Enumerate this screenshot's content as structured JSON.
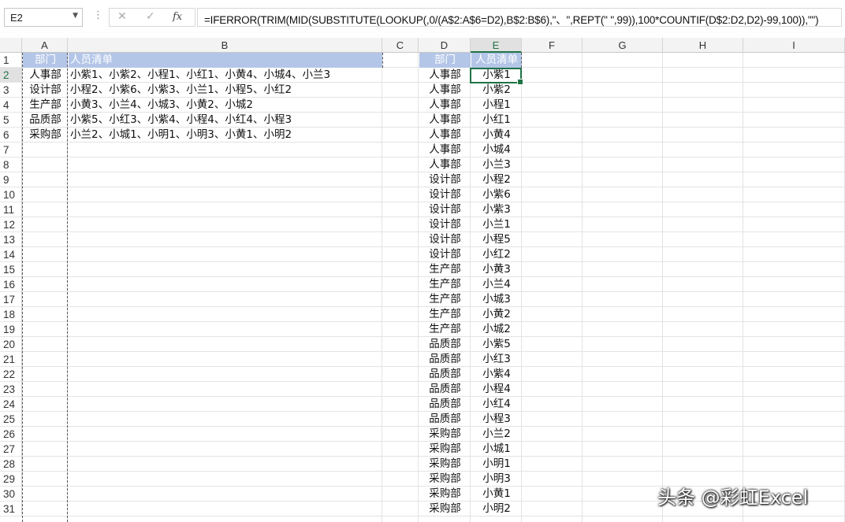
{
  "formula_bar": {
    "name_box": "E2",
    "more_icon": "⋮",
    "cancel_icon": "✕",
    "enter_icon": "✓",
    "fx_icon": "fx",
    "formula": "=IFERROR(TRIM(MID(SUBSTITUTE(LOOKUP(,0/(A$2:A$6=D2),B$2:B$6),\"、\",REPT(\" \",99)),100*COUNTIF(D$2:D2,D2)-99,100)),\"\")"
  },
  "columns": [
    {
      "label": "A"
    },
    {
      "label": "B"
    },
    {
      "label": "C"
    },
    {
      "label": "D"
    },
    {
      "label": "E"
    },
    {
      "label": "F"
    },
    {
      "label": "G"
    },
    {
      "label": "H"
    },
    {
      "label": "I"
    }
  ],
  "rows": [
    "1",
    "2",
    "3",
    "4",
    "5",
    "6",
    "7",
    "8",
    "9",
    "10",
    "11",
    "12",
    "13",
    "14",
    "15",
    "16",
    "17",
    "18",
    "19",
    "20",
    "21",
    "22",
    "23",
    "24",
    "25",
    "26",
    "27",
    "28",
    "29",
    "30",
    "31"
  ],
  "source_table": {
    "header": {
      "dept": "部门",
      "list": "人员清单"
    },
    "rows": [
      {
        "dept": "人事部",
        "list": "小紫1、小紫2、小程1、小红1、小黄4、小城4、小兰3"
      },
      {
        "dept": "设计部",
        "list": "小程2、小紫6、小紫3、小兰1、小程5、小红2"
      },
      {
        "dept": "生产部",
        "list": "小黄3、小兰4、小城3、小黄2、小城2"
      },
      {
        "dept": "品质部",
        "list": "小紫5、小红3、小紫4、小程4、小红4、小程3"
      },
      {
        "dept": "采购部",
        "list": "小兰2、小城1、小明1、小明3、小黄1、小明2"
      }
    ]
  },
  "result_table": {
    "header": {
      "dept": "部门",
      "name": "人员清单"
    },
    "rows": [
      {
        "dept": "人事部",
        "name": "小紫1"
      },
      {
        "dept": "人事部",
        "name": "小紫2"
      },
      {
        "dept": "人事部",
        "name": "小程1"
      },
      {
        "dept": "人事部",
        "name": "小红1"
      },
      {
        "dept": "人事部",
        "name": "小黄4"
      },
      {
        "dept": "人事部",
        "name": "小城4"
      },
      {
        "dept": "人事部",
        "name": "小兰3"
      },
      {
        "dept": "设计部",
        "name": "小程2"
      },
      {
        "dept": "设计部",
        "name": "小紫6"
      },
      {
        "dept": "设计部",
        "name": "小紫3"
      },
      {
        "dept": "设计部",
        "name": "小兰1"
      },
      {
        "dept": "设计部",
        "name": "小程5"
      },
      {
        "dept": "设计部",
        "name": "小红2"
      },
      {
        "dept": "生产部",
        "name": "小黄3"
      },
      {
        "dept": "生产部",
        "name": "小兰4"
      },
      {
        "dept": "生产部",
        "name": "小城3"
      },
      {
        "dept": "生产部",
        "name": "小黄2"
      },
      {
        "dept": "生产部",
        "name": "小城2"
      },
      {
        "dept": "品质部",
        "name": "小紫5"
      },
      {
        "dept": "品质部",
        "name": "小红3"
      },
      {
        "dept": "品质部",
        "name": "小紫4"
      },
      {
        "dept": "品质部",
        "name": "小程4"
      },
      {
        "dept": "品质部",
        "name": "小红4"
      },
      {
        "dept": "品质部",
        "name": "小程3"
      },
      {
        "dept": "采购部",
        "name": "小兰2"
      },
      {
        "dept": "采购部",
        "name": "小城1"
      },
      {
        "dept": "采购部",
        "name": "小明1"
      },
      {
        "dept": "采购部",
        "name": "小明3"
      },
      {
        "dept": "采购部",
        "name": "小黄1"
      },
      {
        "dept": "采购部",
        "name": "小明2"
      }
    ]
  },
  "watermark": "头条 @彩虹Excel",
  "colors": {
    "header_fill": "#b4c6e7",
    "selection": "#217346"
  }
}
